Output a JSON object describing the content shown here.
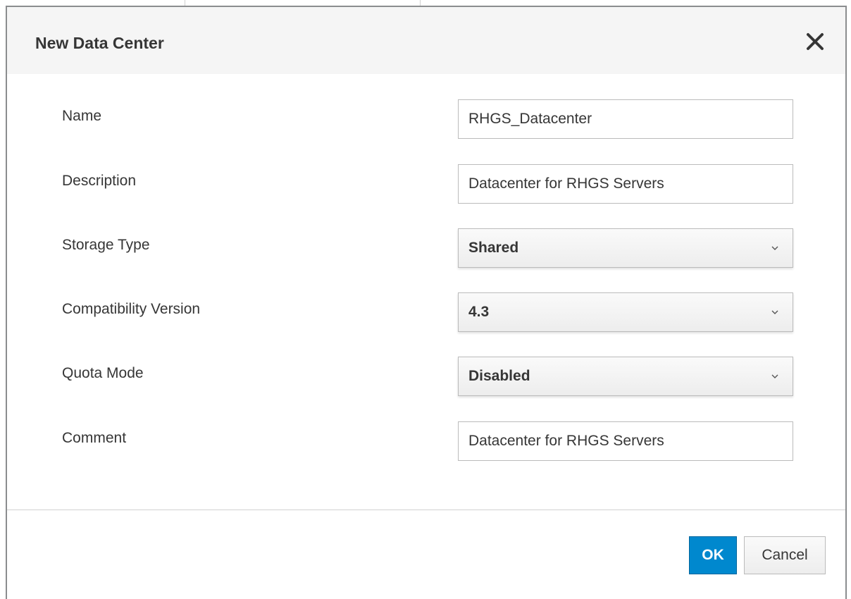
{
  "dialog": {
    "title": "New Data Center",
    "close_icon": "close-icon"
  },
  "form": {
    "name": {
      "label": "Name",
      "value": "RHGS_Datacenter"
    },
    "description": {
      "label": "Description",
      "value": "Datacenter for RHGS Servers"
    },
    "storage_type": {
      "label": "Storage Type",
      "value": "Shared",
      "icon": "chevron-down-icon"
    },
    "compatibility_version": {
      "label": "Compatibility Version",
      "value": "4.3",
      "icon": "chevron-down-icon"
    },
    "quota_mode": {
      "label": "Quota Mode",
      "value": "Disabled",
      "icon": "chevron-down-icon"
    },
    "comment": {
      "label": "Comment",
      "value": "Datacenter for RHGS Servers"
    }
  },
  "footer": {
    "ok_label": "OK",
    "cancel_label": "Cancel"
  },
  "colors": {
    "primary": "#0088ce",
    "header_bg": "#f5f5f5",
    "text": "#363636"
  }
}
